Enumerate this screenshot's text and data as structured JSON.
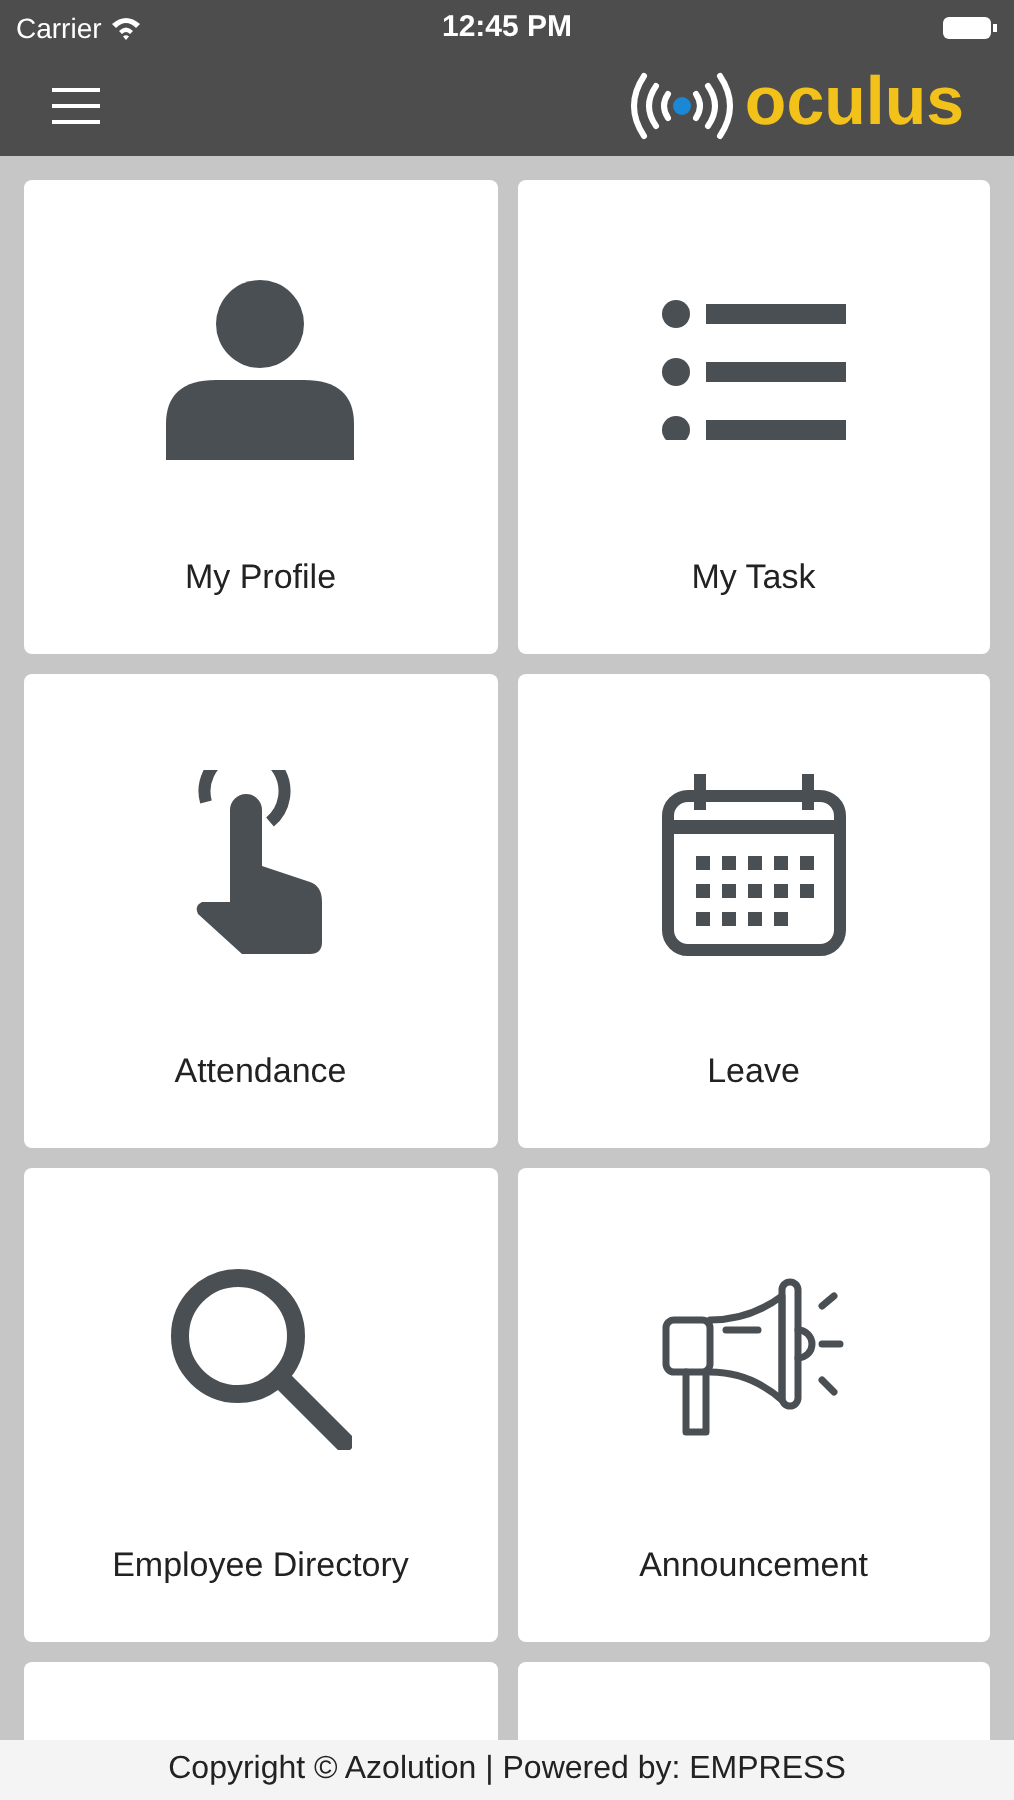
{
  "status_bar": {
    "carrier": "Carrier",
    "time": "12:45 PM"
  },
  "header": {
    "logo_text": "oculus"
  },
  "tiles": [
    {
      "kind": "profile",
      "label": "My Profile"
    },
    {
      "kind": "task",
      "label": "My Task"
    },
    {
      "kind": "attendance",
      "label": "Attendance"
    },
    {
      "kind": "leave",
      "label": "Leave"
    },
    {
      "kind": "directory",
      "label": "Employee Directory"
    },
    {
      "kind": "announcement",
      "label": "Announcement"
    },
    {
      "kind": "hidden"
    },
    {
      "kind": "hidden"
    }
  ],
  "footer": "Copyright © Azolution | Powered by: EMPRESS"
}
